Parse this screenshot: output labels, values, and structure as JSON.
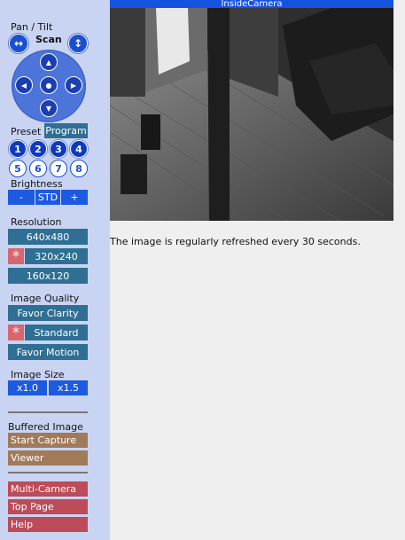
{
  "camera": {
    "title": "InsideCamera",
    "caption": "The image is regularly refreshed every 30 seconds."
  },
  "pan_tilt": {
    "label": "Pan / Tilt",
    "scan_label": "Scan"
  },
  "preset": {
    "label": "Preset",
    "program_label": "Program",
    "buttons": [
      "1",
      "2",
      "3",
      "4",
      "5",
      "6",
      "7",
      "8"
    ]
  },
  "brightness": {
    "label": "Brightness",
    "minus": "-",
    "std": "STD",
    "plus": "+"
  },
  "resolution": {
    "label": "Resolution",
    "options": [
      "640x480",
      "320x240",
      "160x120"
    ],
    "selected_marker": "*"
  },
  "image_quality": {
    "label": "Image Quality",
    "options": [
      "Favor Clarity",
      "Standard",
      "Favor Motion"
    ],
    "selected_marker": "*"
  },
  "image_size": {
    "label": "Image Size",
    "options": [
      "x1.0",
      "x1.5"
    ]
  },
  "buffered": {
    "label": "Buffered Image",
    "start": "Start Capture",
    "viewer": "Viewer"
  },
  "links": [
    "Multi-Camera",
    "Top Page",
    "Help"
  ],
  "colors": {
    "sidebar_bg": "#c9d4f2",
    "accent_blue": "#1c5ae0",
    "teal": "#2f6f93",
    "selected_star": "#d9666f",
    "brown": "#a17a5a",
    "red": "#bd4b59"
  }
}
